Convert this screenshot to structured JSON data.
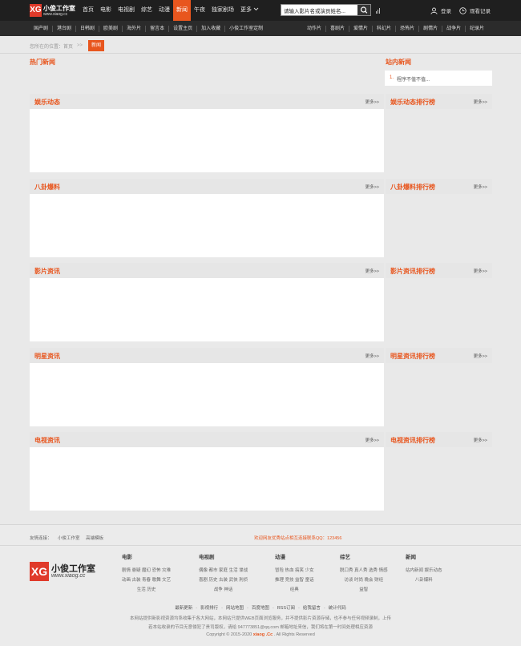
{
  "brand": {
    "name": "小俊工作室",
    "url": "www.xiaog.cc",
    "mark": "XG"
  },
  "nav": [
    "首页",
    "电影",
    "电视剧",
    "综艺",
    "动漫",
    "新闻",
    "午夜",
    "独家剧场",
    "更多"
  ],
  "nav_active": 5,
  "search": {
    "value": "请输入影片名或演员姓名..."
  },
  "header_actions": {
    "login": "登录",
    "history": "观看记录"
  },
  "subnav_left": [
    "国产剧",
    "港台剧",
    "日韩剧",
    "欧美剧",
    "海外片",
    "留言本",
    "设置主页",
    "加入收藏",
    "小俊工作室定制"
  ],
  "subnav_right": [
    "动作片",
    "喜剧片",
    "爱情片",
    "科幻片",
    "恐怖片",
    "剧情片",
    "战争片",
    "纪录片"
  ],
  "breadcrumb": {
    "prefix": "您所在的位置：",
    "home": "首页",
    "sep": ">>",
    "current": "新闻"
  },
  "hot_news": {
    "title": "热门新闻"
  },
  "site_news": {
    "title": "站内新闻",
    "items": [
      {
        "num": "1.",
        "text": "程序不值不值..."
      }
    ]
  },
  "sections": [
    {
      "title": "娱乐动态",
      "more": "更多>>",
      "rank_title": "娱乐动态排行榜",
      "rank_more": "更多>>"
    },
    {
      "title": "八卦爆料",
      "more": "更多>>",
      "rank_title": "八卦爆料排行榜",
      "rank_more": "更多>>"
    },
    {
      "title": "影片资讯",
      "more": "更多>>",
      "rank_title": "影片资讯排行榜",
      "rank_more": "更多>>"
    },
    {
      "title": "明星资讯",
      "more": "更多>>",
      "rank_title": "明星资讯排行榜",
      "rank_more": "更多>>"
    },
    {
      "title": "电视资讯",
      "more": "更多>>",
      "rank_title": "电视资讯排行榜",
      "rank_more": "更多>>"
    }
  ],
  "footer": {
    "friend_label": "友情连接：",
    "friend_links": [
      "小俊工作室",
      "高端模板"
    ],
    "contact": "欢迎网友优秀站点相互连接联系QQ：123456",
    "columns": [
      {
        "title": "电影",
        "rows": [
          "剧情 悬疑 魔幻 恐怖 灾难",
          "动画 古装 青春 歌舞 文艺",
          "生活 历史"
        ]
      },
      {
        "title": "电视剧",
        "rows": [
          "偶像 都市 家庭 生活 谍战",
          "喜剧 历史 古装 武侠 刑侦",
          "战争 神话"
        ]
      },
      {
        "title": "动漫",
        "rows": [
          "冒险 热血 搞笑 少女",
          "推理 竞技 益智 童话",
          "经典"
        ]
      },
      {
        "title": "综艺",
        "rows": [
          "脱口秀 真人秀 选秀 情感",
          "访谈 时尚 晚会 财经",
          "益智"
        ]
      },
      {
        "title": "新闻",
        "rows": [
          "站内新闻 娱乐动态",
          "八卦爆料"
        ]
      }
    ],
    "links": [
      "最新更新",
      "影视排行",
      "网站地图",
      "百度地图",
      "RSS订阅",
      "给我留言",
      "统计代码"
    ],
    "disclaimer1": "本网站提供新影视资源均系收集于各大网站，本网站只提供WEB页面浏览服务，并不提供影片资源存储，也不参与任何视频录制，上传",
    "disclaimer2": "若本站收录的节目无意侵犯了贵司版权，请给 947773851@qq.com 邮箱地址来信，我们将在第一时间处理相应资源",
    "copyright_pre": "Copyright © 2015-2020",
    "copyright_brand": "xiaog .Cc",
    "copyright_post": ". All Rights Reserved"
  },
  "colors": {
    "accent": "#e8561e",
    "header_bg": "#1f1f1f",
    "subbar_bg": "#2b2b2b",
    "page_bg": "#e9e9e9"
  }
}
